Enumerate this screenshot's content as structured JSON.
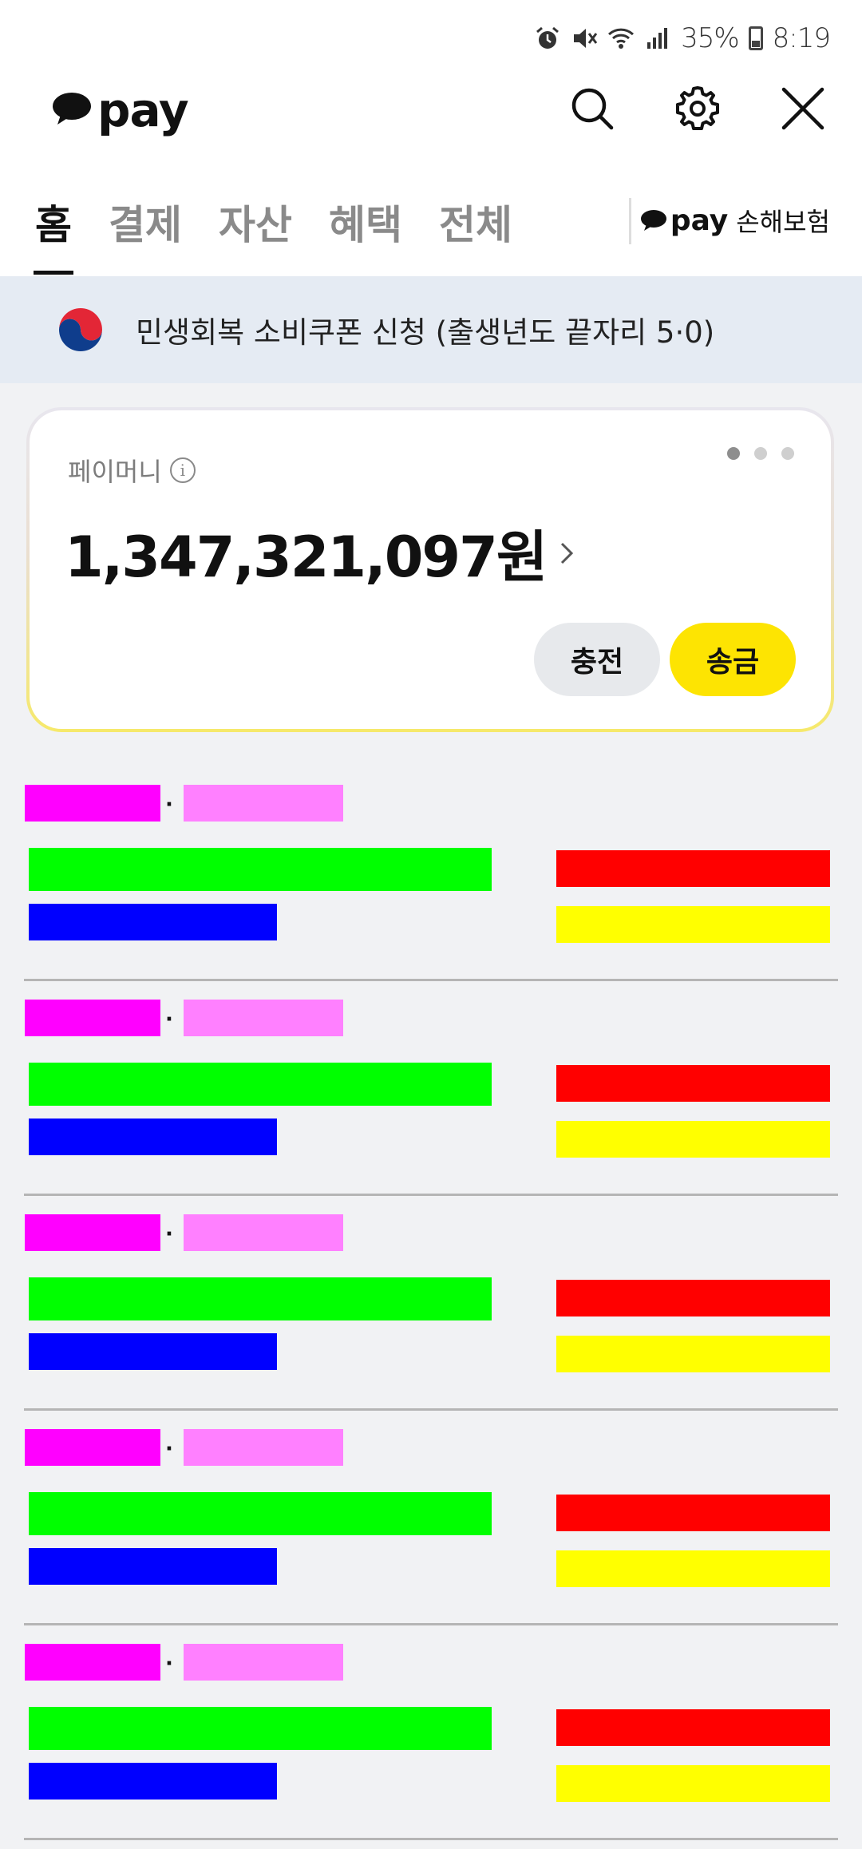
{
  "status_bar": {
    "battery": "35%",
    "time": "8:19",
    "icons": [
      "alarm-icon",
      "mute-icon",
      "wifi-icon",
      "signal-icon",
      "battery-icon"
    ]
  },
  "header": {
    "logo_text": "pay",
    "actions": [
      "search-icon",
      "settings-icon",
      "close-icon"
    ]
  },
  "tabs": [
    {
      "label": "홈",
      "active": true
    },
    {
      "label": "결제",
      "active": false
    },
    {
      "label": "자산",
      "active": false
    },
    {
      "label": "혜택",
      "active": false
    },
    {
      "label": "전체",
      "active": false
    }
  ],
  "insurance_link": {
    "pay": "pay",
    "label": "손해보험"
  },
  "banner": {
    "text": "민생회복 소비쿠폰 신청 (출생년도 끝자리 5·0)"
  },
  "money_card": {
    "label": "페이머니",
    "balance": "1,347,321,097원",
    "pager": {
      "count": 3,
      "current": 1
    },
    "charge_label": "충전",
    "send_label": "송금"
  },
  "rows": [
    {
      "separator": "·"
    },
    {
      "separator": "·"
    },
    {
      "separator": "·"
    },
    {
      "separator": "·"
    },
    {
      "separator": "·"
    }
  ],
  "colors": {
    "accent_yellow": "#fde402",
    "banner_bg": "#e5ebf3",
    "page_bg": "#f1f2f4"
  }
}
